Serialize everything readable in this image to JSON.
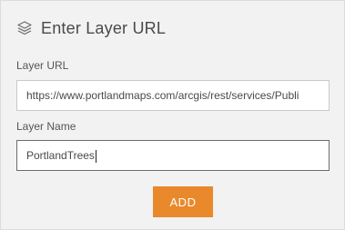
{
  "header": {
    "icon": "layers-icon",
    "title": "Enter Layer URL"
  },
  "form": {
    "url_label": "Layer URL",
    "url_value": "https://www.portlandmaps.com/arcgis/rest/services/Publi",
    "name_label": "Layer Name",
    "name_value": "PortlandTrees"
  },
  "actions": {
    "add_label": "ADD"
  },
  "colors": {
    "button": "#e9892b",
    "panel_bg": "#f2f2f2"
  }
}
